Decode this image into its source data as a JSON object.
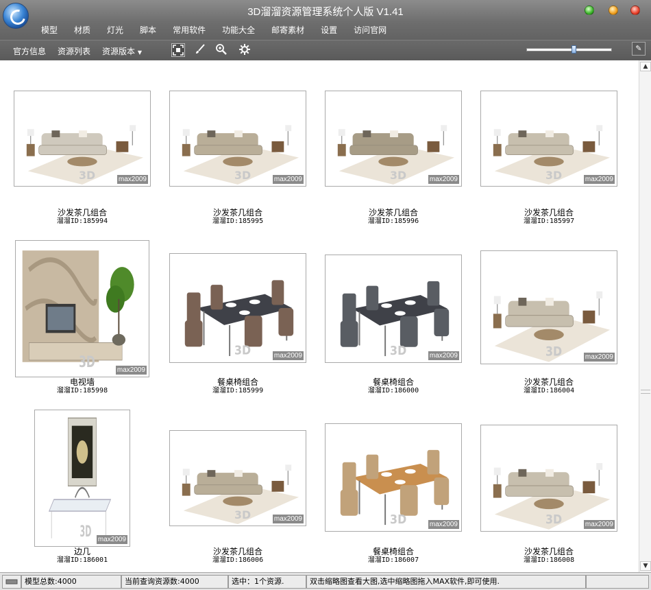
{
  "app": {
    "title": "3D溜溜资源管理系统个人版 V1.41"
  },
  "menu": [
    "模型",
    "材质",
    "灯光",
    "脚本",
    "常用软件",
    "功能大全",
    "邮寄素材",
    "设置",
    "访问官网"
  ],
  "toolbar": {
    "items": [
      "官方信息",
      "资源列表",
      "资源版本"
    ],
    "dropdown_arrow": "▼",
    "icons": [
      "fit-view-icon",
      "brush-icon",
      "zoom-icon",
      "settings-gear-icon"
    ]
  },
  "zoom_slider": {
    "value": 0.56
  },
  "watermark": "max2009",
  "resources": [
    {
      "name": "沙发茶几组合",
      "id": "溜溜ID:185994",
      "scene": "sofa"
    },
    {
      "name": "沙发茶几组合",
      "id": "溜溜ID:185995",
      "scene": "sofa"
    },
    {
      "name": "沙发茶几组合",
      "id": "溜溜ID:185996",
      "scene": "sofa"
    },
    {
      "name": "沙发茶几组合",
      "id": "溜溜ID:185997",
      "scene": "sofa"
    },
    {
      "name": "电视墙",
      "id": "溜溜ID:185998",
      "scene": "tv"
    },
    {
      "name": "餐桌椅组合",
      "id": "溜溜ID:185999",
      "scene": "dining"
    },
    {
      "name": "餐桌椅组合",
      "id": "溜溜ID:186000",
      "scene": "dining"
    },
    {
      "name": "沙发茶几组合",
      "id": "溜溜ID:186004",
      "scene": "sofa"
    },
    {
      "name": "边几",
      "id": "溜溜ID:186001",
      "scene": "side"
    },
    {
      "name": "沙发茶几组合",
      "id": "溜溜ID:186006",
      "scene": "sofa"
    },
    {
      "name": "餐桌椅组合",
      "id": "溜溜ID:186007",
      "scene": "dining"
    },
    {
      "name": "沙发茶几组合",
      "id": "溜溜ID:186008",
      "scene": "sofa"
    }
  ],
  "status": {
    "total": "模型总数:4000",
    "query": "当前查询资源数:4000",
    "selected": "选中：1个资源.",
    "hint": "双击缩略图查看大图,选中缩略图拖入MAX软件,即可使用."
  }
}
